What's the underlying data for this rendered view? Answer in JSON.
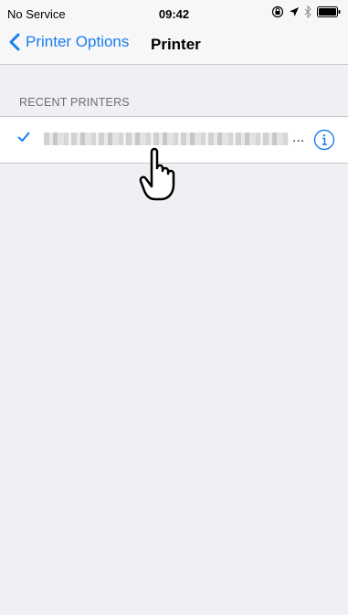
{
  "status_bar": {
    "carrier": "No Service",
    "time": "09:42"
  },
  "nav": {
    "back_label": "Printer Options",
    "title": "Printer"
  },
  "section": {
    "header": "RECENT PRINTERS"
  },
  "printer_row": {
    "ellipsis": "...",
    "selected": true
  },
  "colors": {
    "accent": "#1a7df0",
    "background": "#efeff4"
  },
  "icons": [
    "chevron-left-icon",
    "checkmark-icon",
    "info-icon",
    "location-arrow-icon",
    "bluetooth-icon",
    "battery-icon",
    "orientation-lock-icon",
    "hand-pointer-icon"
  ]
}
